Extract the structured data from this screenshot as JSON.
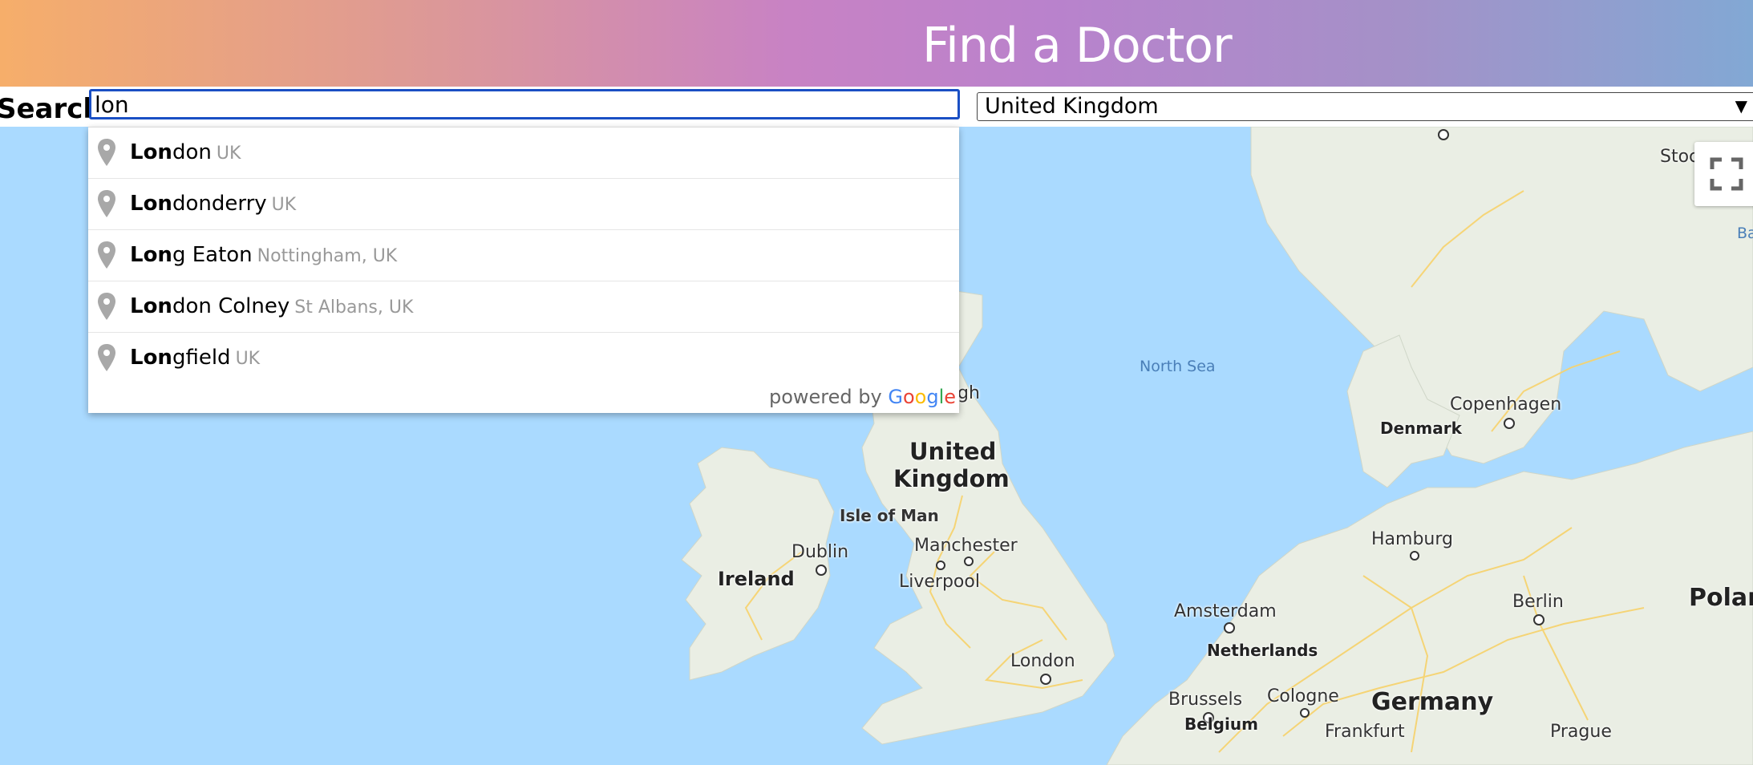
{
  "header": {
    "title": "Find a Doctor"
  },
  "search": {
    "label": "Search",
    "value": "lon",
    "country": "United Kingdom"
  },
  "suggestions": [
    {
      "match": "Lon",
      "rest": "don",
      "secondary": "UK"
    },
    {
      "match": "Lon",
      "rest": "donderry",
      "secondary": "UK"
    },
    {
      "match": "Lon",
      "rest": "g Eaton",
      "secondary": "Nottingham, UK"
    },
    {
      "match": "Lon",
      "rest": "don Colney",
      "secondary": "St Albans, UK"
    },
    {
      "match": "Lon",
      "rest": "gfield",
      "secondary": "UK"
    }
  ],
  "powered_by": {
    "prefix": "powered by",
    "brand": "Google"
  },
  "map_labels": {
    "north_sea": "North Sea",
    "uk": "United Kingdom",
    "uk_line1": "United",
    "uk_line2": "Kingdom",
    "isle_of_man": "Isle of Man",
    "ireland": "Ireland",
    "dublin": "Dublin",
    "manchester": "Manchester",
    "liverpool": "Liverpool",
    "london": "London",
    "denmark": "Denmark",
    "copenhagen": "Copenhagen",
    "hamburg": "Hamburg",
    "amsterdam": "Amsterdam",
    "netherlands": "Netherlands",
    "berlin": "Berlin",
    "germany": "Germany",
    "brussels": "Brussels",
    "belgium": "Belgium",
    "cologne": "Cologne",
    "frankfurt": "Frankfurt",
    "prague": "Prague",
    "poland_partial": "Polan",
    "stockholm_partial": "Stoc",
    "baltic_partial": "Ba",
    "edinburgh_partial": "gh"
  },
  "colors": {
    "land": "#eaeee4",
    "water": "#aadaff",
    "road": "#f7d26a",
    "accent": "#1a4fc4"
  }
}
